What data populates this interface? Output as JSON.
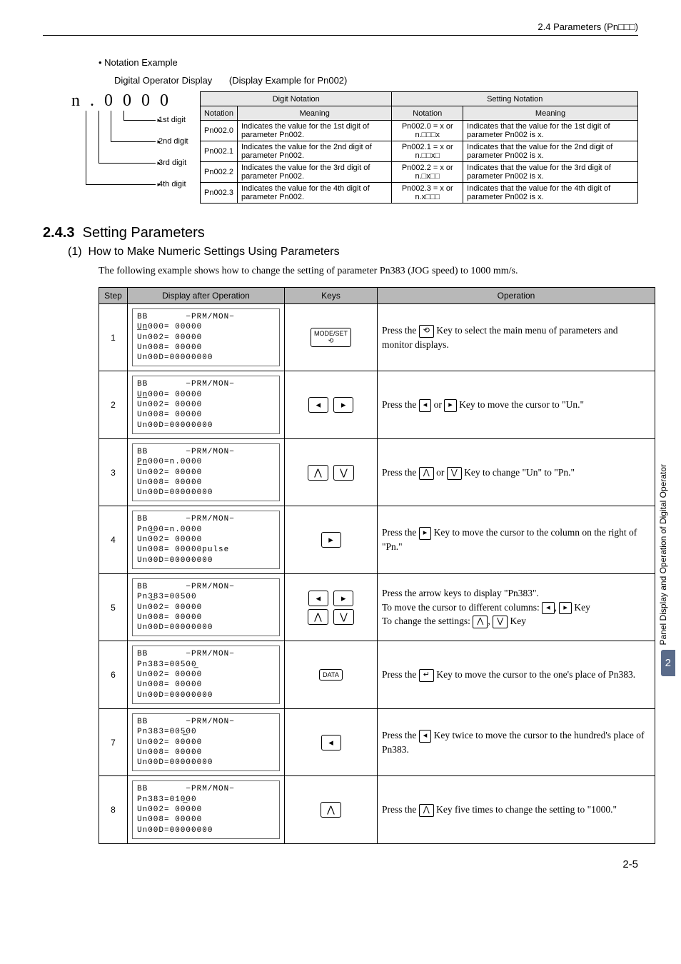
{
  "header": {
    "crumb": "2.4  Parameters (Pn□□□)"
  },
  "notation_example": {
    "bullet": "•  Notation Example",
    "dop_label": "Digital Operator Display",
    "dop_example": "(Display Example for Pn002)",
    "diag_title": "n . 0 0 0 0",
    "diag_labels": [
      "1st digit",
      "2nd digit",
      "3rd digit",
      "4th digit"
    ],
    "group_headers": [
      "Digit Notation",
      "Setting Notation"
    ],
    "sub_headers": [
      "Notation",
      "Meaning",
      "Notation",
      "Meaning"
    ],
    "rows": [
      {
        "d": "Pn002.0",
        "dm": "Indicates the value for the 1st digit of parameter Pn002.",
        "s": "Pn002.0 = x or n.□□□x",
        "sm": "Indicates that the value for the 1st digit of parameter Pn002 is x."
      },
      {
        "d": "Pn002.1",
        "dm": "Indicates the value for the 2nd digit of parameter Pn002.",
        "s": "Pn002.1 = x or n.□□x□",
        "sm": "Indicates that the value for the 2nd digit of parameter Pn002 is x."
      },
      {
        "d": "Pn002.2",
        "dm": "Indicates the value for the 3rd digit of parameter Pn002.",
        "s": "Pn002.2 = x or n.□x□□",
        "sm": "Indicates that the value for the 3rd digit of parameter Pn002 is x."
      },
      {
        "d": "Pn002.3",
        "dm": "Indicates the value for the 4th digit of parameter Pn002.",
        "s": "Pn002.3 = x or n.x□□□",
        "sm": "Indicates that the value for the 4th digit of parameter Pn002 is x."
      }
    ]
  },
  "section": {
    "num": "2.4.3",
    "title": "Setting Parameters",
    "sub_num": "(1)",
    "sub_title": "How to Make Numeric Settings Using Parameters",
    "intro": "The following example shows how to change the setting of parameter Pn383 (JOG speed) to 1000 mm/s."
  },
  "steps_headers": [
    "Step",
    "Display after Operation",
    "Keys",
    "Operation"
  ],
  "steps": [
    {
      "n": "1",
      "lcd": "BB       −PRM/MON−\nU̲n̲000= 00000\nUn002= 00000\nUn008= 00000\nUn00D=00000000",
      "keys": "modeset",
      "op_html": "Press the <span class=\"keybtn-inline\">⟲</span> Key to select the main menu of parameters and monitor displays."
    },
    {
      "n": "2",
      "lcd": "BB       −PRM/MON−\nU̲n̲000= 00000\nUn002= 00000\nUn008= 00000\nUn00D=00000000",
      "keys": "lr",
      "op_html": "Press the <span class=\"keybtn-inline\">◂</span> or <span class=\"keybtn-inline\">▸</span> Key to move the cursor to \"Un.\""
    },
    {
      "n": "3",
      "lcd": "BB       −PRM/MON−\nP̲n̲000=n.0000\nUn002= 00000\nUn008= 00000\nUn00D=00000000",
      "keys": "ud",
      "op_html": "Press the <span class=\"keybtn-inline\">⋀</span> or <span class=\"keybtn-inline\">⋁</span> Key to change \"Un\" to \"Pn.\""
    },
    {
      "n": "4",
      "lcd": "BB       −PRM/MON−\nPn0̲00=n.0000\nUn002= 00000\nUn008= 00000pulse\nUn00D=00000000",
      "keys": "r",
      "op_html": "Press the <span class=\"keybtn-inline\">▸</span> Key to move the cursor to the column on the right of \"Pn.\""
    },
    {
      "n": "5",
      "lcd": "BB       −PRM/MON−\nPn3̲83=00500\nUn002= 00000\nUn008= 00000\nUn00D=00000000",
      "keys": "lrud",
      "op_html": "Press the arrow keys to display \"Pn383\".<br>To move the cursor to different columns: <span class=\"keybtn-inline\">◂</span>, <span class=\"keybtn-inline\">▸</span> Key<br>To change the settings: <span class=\"keybtn-inline\">⋀</span>, <span class=\"keybtn-inline\">⋁</span> Key"
    },
    {
      "n": "6",
      "lcd": "BB       −PRM/MON−\nPn383=00500̲\nUn002= 00000\nUn008= 00000\nUn00D=00000000",
      "keys": "data",
      "op_html": "Press the <span class=\"keybtn-inline\">↵</span> Key to move the cursor to the one's place of Pn383."
    },
    {
      "n": "7",
      "lcd": "BB       −PRM/MON−\nPn383=005̲00\nUn002= 00000\nUn008= 00000\nUn00D=00000000",
      "keys": "l",
      "op_html": "Press the <span class=\"keybtn-inline\">◂</span> Key twice to move the cursor to the hundred's place of Pn383."
    },
    {
      "n": "8",
      "lcd": "BB       −PRM/MON−\nPn383=010̲00\nUn002= 00000\nUn008= 00000\nUn00D=00000000",
      "keys": "u",
      "op_html": "Press the <span class=\"keybtn-inline\">⋀</span> Key five times to change the setting to \"1000.\""
    }
  ],
  "keys_labels": {
    "modeset": "MODE/SET",
    "data": "DATA",
    "left": "◂",
    "right": "▸",
    "up": "⋀",
    "down": "⋁",
    "enter": "⟲"
  },
  "side_text": "Panel Display and Operation of Digital Operator",
  "side_badge": "2",
  "page_num": "2-5"
}
